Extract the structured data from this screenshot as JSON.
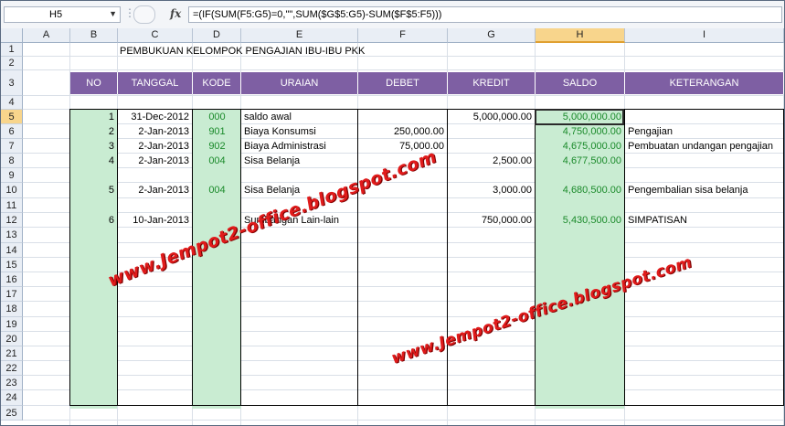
{
  "formula_bar": {
    "name_box": "H5",
    "fx_label": "fx",
    "formula": "=(IF(SUM(F5:G5)=0,\"\",SUM($G$5:G5)-SUM($F$5:F5)))"
  },
  "columns": [
    "A",
    "B",
    "C",
    "D",
    "E",
    "F",
    "G",
    "H",
    "I"
  ],
  "rows": [
    "1",
    "2",
    "3",
    "4",
    "5",
    "6",
    "7",
    "8",
    "9",
    "10",
    "11",
    "12",
    "13",
    "14",
    "15",
    "16",
    "17",
    "18",
    "19",
    "20",
    "21",
    "22",
    "23",
    "24",
    "25"
  ],
  "title": "PEMBUKUAN KELOMPOK PENGAJIAN IBU-IBU PKK",
  "table_headers": [
    "NO",
    "TANGGAL",
    "KODE",
    "URAIAN",
    "DEBET",
    "KREDIT",
    "SALDO",
    "KETERANGAN"
  ],
  "entries": [
    {
      "no": "1",
      "tanggal": "31-Dec-2012",
      "kode": "000",
      "uraian": "saldo awal",
      "debet": "",
      "kredit": "5,000,000.00",
      "saldo": "5,000,000.00",
      "ket": ""
    },
    {
      "no": "2",
      "tanggal": "2-Jan-2013",
      "kode": "901",
      "uraian": "Biaya Konsumsi",
      "debet": "250,000.00",
      "kredit": "",
      "saldo": "4,750,000.00",
      "ket": "Pengajian"
    },
    {
      "no": "3",
      "tanggal": "2-Jan-2013",
      "kode": "902",
      "uraian": "Biaya Administrasi",
      "debet": "75,000.00",
      "kredit": "",
      "saldo": "4,675,000.00",
      "ket": "Pembuatan undangan pengajian"
    },
    {
      "no": "4",
      "tanggal": "2-Jan-2013",
      "kode": "004",
      "uraian": "Sisa Belanja",
      "debet": "",
      "kredit": "2,500.00",
      "saldo": "4,677,500.00",
      "ket": ""
    },
    {
      "no": "5",
      "tanggal": "2-Jan-2013",
      "kode": "004",
      "uraian": "Sisa Belanja",
      "debet": "",
      "kredit": "3,000.00",
      "saldo": "4,680,500.00",
      "ket": "Pengembalian sisa belanja"
    },
    {
      "no": "6",
      "tanggal": "10-Jan-2013",
      "kode": "",
      "uraian": "Sumbangan Lain-lain",
      "debet": "",
      "kredit": "750,000.00",
      "saldo": "5,430,500.00",
      "ket": "SIMPATISAN"
    }
  ],
  "watermark": "www.Jempot2-office.blogspot.com",
  "colors": {
    "header_purple": "#7e5fa3",
    "band_green": "#c9ecd2",
    "watermark_red": "#e01b1b",
    "selected_header": "#f8d58c"
  }
}
